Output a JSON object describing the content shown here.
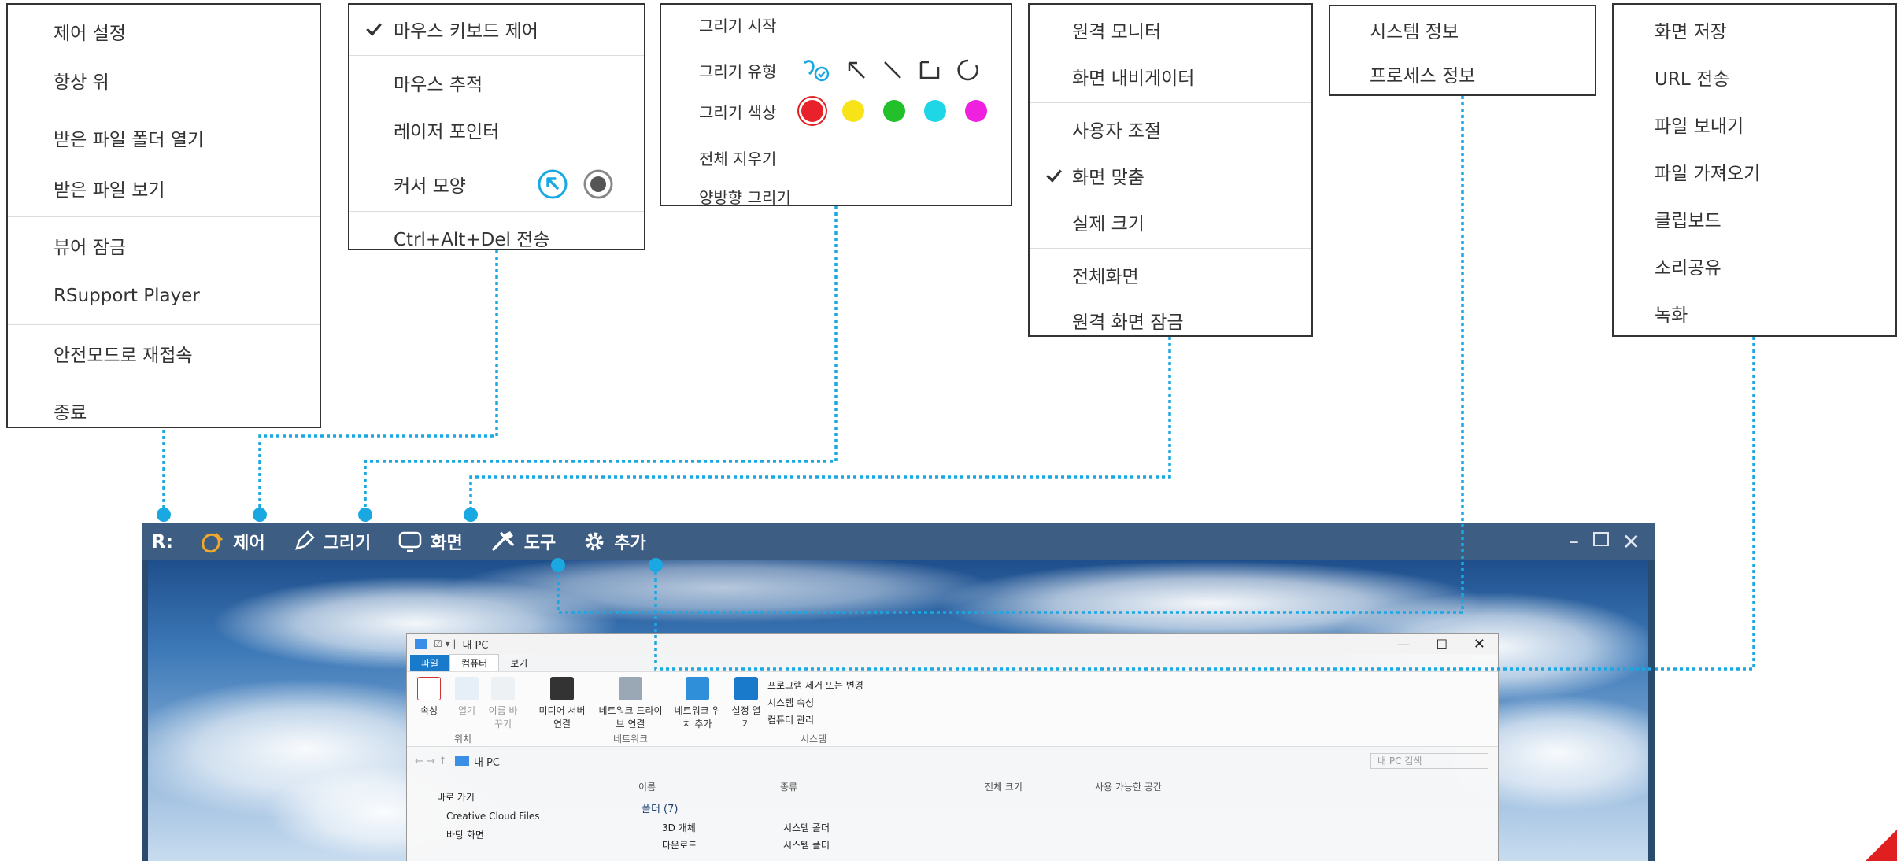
{
  "menus": {
    "main": [
      "제어 설정",
      "항상 위",
      "받은 파일 폴더 열기",
      "받은 파일 보기",
      "뷰어 잠금",
      "RSupport Player",
      "안전모드로 재접속",
      "종료"
    ],
    "control": {
      "items": [
        "마우스 키보드 제어",
        "마우스 추적",
        "레이저 포인터"
      ],
      "cursor_label": "커서 모양",
      "cad": "Ctrl+Alt+Del 전송"
    },
    "draw": {
      "start": "그리기 시작",
      "type_label": "그리기 유형",
      "color_label": "그리기 색상",
      "colors": [
        "#e8222a",
        "#f7e317",
        "#22c02a",
        "#1ed6e6",
        "#ef21de"
      ],
      "clear": "전체 지우기",
      "bidirectional": "양방향 그리기"
    },
    "screen": [
      "원격 모니터",
      "화면 내비게이터",
      "사용자 조절",
      "화면 맞춤",
      "실제 크기",
      "전체화면",
      "원격 화면 잠금"
    ],
    "tools": [
      "시스템 정보",
      "프로세스 정보"
    ],
    "extra": [
      "화면 저장",
      "URL 전송",
      "파일 보내기",
      "파일 가져오기",
      "클립보드",
      "소리공유",
      "녹화"
    ]
  },
  "colors": {
    "accent": "#1aa8e2",
    "titlebar": "#3d5d82",
    "menu_border": "#333333",
    "control_icon": "#f0a82c"
  },
  "viewer": {
    "logo": "R:",
    "tabs": [
      {
        "label": "제어",
        "icon": "control-icon"
      },
      {
        "label": "그리기",
        "icon": "pen-icon"
      },
      {
        "label": "화면",
        "icon": "monitor-icon"
      },
      {
        "label": "도구",
        "icon": "tools-icon"
      },
      {
        "label": "추가",
        "icon": "gear-icon"
      }
    ],
    "window_controls": [
      "minimize-icon",
      "maximize-icon",
      "close-icon"
    ]
  },
  "explorer": {
    "title": "내 PC",
    "tabs": [
      "파일",
      "컴퓨터",
      "보기"
    ],
    "ribbon": {
      "location_group": "위치",
      "location_buttons": [
        "속성",
        "열기",
        "이름 바꾸기"
      ],
      "network_group": "네트워크",
      "network_buttons": [
        "미디어 서버 연결",
        "네트워크 드라이브 연결",
        "네트워크 위치 추가"
      ],
      "system_group": "시스템",
      "system_open": "설정 열기",
      "system_links": [
        "프로그램 제거 또는 변경",
        "시스템 속성",
        "컴퓨터 관리"
      ]
    },
    "address": "내 PC",
    "search_placeholder": "내 PC 검색",
    "nav_items": [
      "바로 가기",
      "Creative Cloud Files",
      "바탕 화면"
    ],
    "columns": [
      "이름",
      "종류",
      "전체 크기",
      "사용 가능한 공간"
    ],
    "group": "폴더 (7)",
    "rows": [
      {
        "name": "3D 개체",
        "type": "시스템 폴더"
      },
      {
        "name": "다운로드",
        "type": "시스템 폴더"
      }
    ]
  }
}
